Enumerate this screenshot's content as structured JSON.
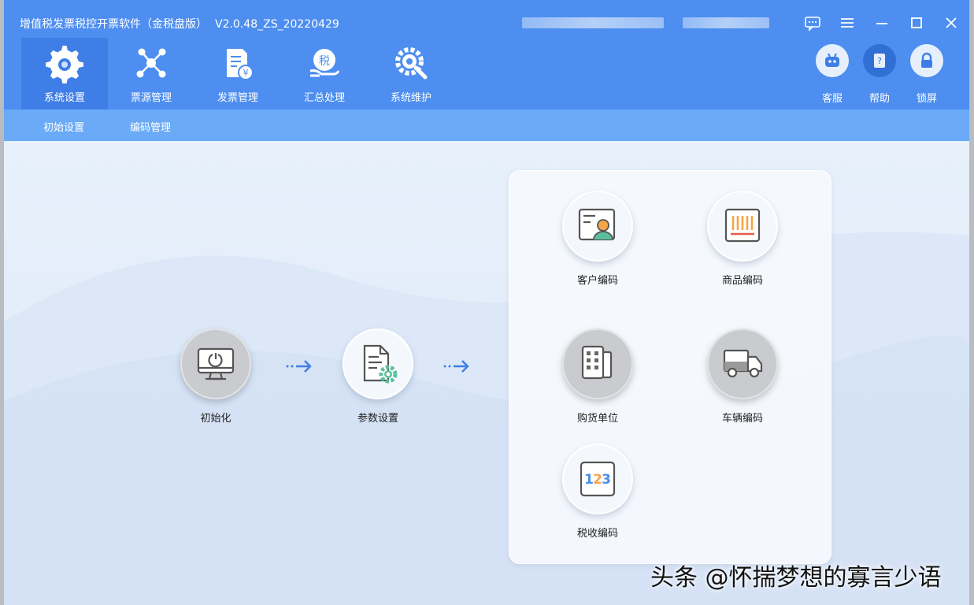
{
  "window": {
    "title": "增值税发票税控开票软件（金税盘版）",
    "version": "V2.0.48_ZS_20220429"
  },
  "nav": {
    "items": [
      {
        "label": "系统设置",
        "icon": "gear-icon",
        "active": true
      },
      {
        "label": "票源管理",
        "icon": "network-icon",
        "active": false
      },
      {
        "label": "发票管理",
        "icon": "invoice-icon",
        "active": false
      },
      {
        "label": "汇总处理",
        "icon": "tax-summary-icon",
        "active": false
      },
      {
        "label": "系统维护",
        "icon": "wrench-gear-icon",
        "active": false
      }
    ]
  },
  "tools": {
    "service": "客服",
    "help": "帮助",
    "lock": "锁屏"
  },
  "subnav": {
    "items": [
      "初始设置",
      "编码管理"
    ]
  },
  "flow": {
    "init": "初始化",
    "params": "参数设置"
  },
  "codes": {
    "customer": "客户编码",
    "product": "商品编码",
    "buyer_unit": "购货单位",
    "vehicle": "车辆编码",
    "tax": "税收编码",
    "tax_icon_digits": [
      "1",
      "2",
      "3"
    ]
  },
  "colors": {
    "header": "#4d8ef0",
    "active_tab": "#3f7ee6",
    "subnav": "#6aaaf7",
    "accent_orange": "#f5a54a",
    "accent_green": "#5bbf9c",
    "accent_blue": "#4a8fe8"
  },
  "watermark": "头条 @怀揣梦想的寡言少语"
}
